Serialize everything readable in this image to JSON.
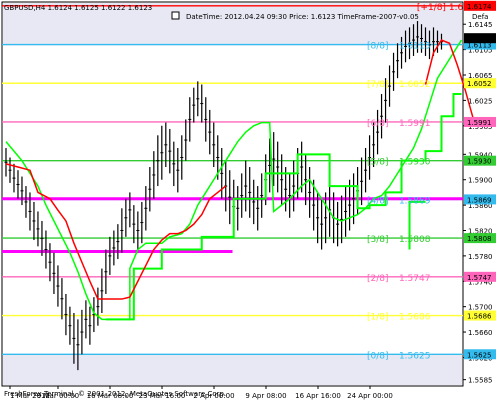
{
  "window": {
    "title": "GBPUSD,H4  1.6124 1.6125 1.6122 1.6123",
    "info_text": "DateTime: 2012.04.24 09:30   Price: 1.6123   TimeFrame-2007-v0.05",
    "info_right": "Defa",
    "copyright": "FreshForex Terminal, © 2001-2012, MetaQuotes Software Corp."
  },
  "colors": {
    "background": "#ffffff",
    "shade": "#e8e8f4",
    "candles": "#000000",
    "red_line": "#ff0000",
    "green_line": "#00ff00",
    "magenta_line": "#ff00ff"
  },
  "chart_data": {
    "type": "line",
    "symbol": "GBPUSD",
    "timeframe": "H4",
    "ylim": [
      1.5575,
      1.618
    ],
    "x_ticks": [
      "1 Mar 2012",
      "9 Mar 00:00",
      "16 Mar 08:00",
      "23 Mar 16:00",
      "2 Apr 00:00",
      "9 Apr 08:00",
      "16 Apr 16:00",
      "24 Apr 00:00"
    ],
    "y_ticks": [
      "1.6145",
      "1.6105",
      "1.6065",
      "1.6025",
      "1.5985",
      "1.5940",
      "1.5900",
      "1.5860",
      "1.5820",
      "1.5780",
      "1.5740",
      "1.5700",
      "1.5660",
      "1.5620",
      "1.5585"
    ],
    "murrey_levels": [
      {
        "label": "[+1/8]",
        "value": "1.6174",
        "y": 1.6174,
        "color": "#ff0000"
      },
      {
        "label": "[8/8]",
        "value": "1.6113",
        "y": 1.6113,
        "color": "#33bbee"
      },
      {
        "label": "[7/8]",
        "value": "1.6052",
        "y": 1.6052,
        "color": "#ffff33"
      },
      {
        "label": "[6/8]",
        "value": "1.5991",
        "y": 1.5991,
        "color": "#ff66bb"
      },
      {
        "label": "[5/8]",
        "value": "1.5930",
        "y": 1.593,
        "color": "#33cc33"
      },
      {
        "label": "[4/8]",
        "value": "1.5869",
        "y": 1.5869,
        "color": "#33bbee"
      },
      {
        "label": "[3/8]",
        "value": "1.5808",
        "y": 1.5808,
        "color": "#33cc33"
      },
      {
        "label": "[2/8]",
        "value": "1.5747",
        "y": 1.5747,
        "color": "#ff66bb"
      },
      {
        "label": "[1/8]",
        "value": "1.5686",
        "y": 1.5686,
        "color": "#ffff33"
      },
      {
        "label": "[0/8]",
        "value": "1.5625",
        "y": 1.5625,
        "color": "#33bbee"
      }
    ],
    "price_tags": [
      {
        "value": "1.6174",
        "y": 1.6174,
        "color": "#ff0000",
        "text_color": "#ffffff"
      },
      {
        "value": "1.6113",
        "y": 1.6113,
        "color": "#33bbee",
        "text_color": "#ffffff"
      },
      {
        "value": "1.6052",
        "y": 1.6052,
        "color": "#ffff33",
        "text_color": "#ffffff"
      },
      {
        "value": "1.5991",
        "y": 1.5991,
        "color": "#ff66bb",
        "text_color": "#ffffff"
      },
      {
        "value": "1.5930",
        "y": 1.593,
        "color": "#33cc33",
        "text_color": "#ffffff"
      },
      {
        "value": "1.5869",
        "y": 1.5869,
        "color": "#33bbee",
        "text_color": "#ffffff"
      },
      {
        "value": "1.5808",
        "y": 1.5808,
        "color": "#33cc33",
        "text_color": "#ffffff"
      },
      {
        "value": "1.5747",
        "y": 1.5747,
        "color": "#ff66bb",
        "text_color": "#ffffff"
      },
      {
        "value": "1.5686",
        "y": 1.5686,
        "color": "#ffff33",
        "text_color": "#ffffff"
      },
      {
        "value": "1.5625",
        "y": 1.5625,
        "color": "#33bbee",
        "text_color": "#ffffff"
      },
      {
        "value": "1.6123",
        "y": 1.6123,
        "color": "#000000",
        "text_color": "#ffffff"
      }
    ],
    "magenta_levels": [
      1.587,
      1.5787
    ],
    "red_line": [
      [
        1,
        1.5925
      ],
      [
        4,
        1.592
      ],
      [
        7,
        1.5915
      ],
      [
        9,
        1.588
      ],
      [
        12,
        1.587
      ],
      [
        14,
        1.5852
      ],
      [
        16,
        1.5835
      ],
      [
        18,
        1.58
      ],
      [
        20,
        1.577
      ],
      [
        22,
        1.574
      ],
      [
        24,
        1.5712
      ],
      [
        26,
        1.5712
      ],
      [
        30,
        1.5712
      ],
      [
        32,
        1.5715
      ],
      [
        34,
        1.574
      ],
      [
        36,
        1.5765
      ],
      [
        38,
        1.579
      ],
      [
        40,
        1.5805
      ],
      [
        42,
        1.5815
      ],
      [
        44,
        1.5815
      ],
      [
        46,
        1.582
      ],
      [
        48,
        1.583
      ],
      [
        50,
        1.5845
      ],
      [
        52,
        1.587
      ],
      [
        54,
        1.588
      ],
      [
        56,
        1.589
      ],
      [
        58,
        1.591
      ],
      [
        60,
        1.594
      ],
      [
        62,
        1.595
      ],
      [
        64,
        1.5955
      ],
      [
        66,
        1.599
      ],
      [
        68,
        1.6
      ],
      [
        70,
        1.599
      ],
      [
        72,
        1.596
      ],
      [
        74,
        1.594
      ],
      [
        76,
        1.591
      ],
      [
        78,
        1.589
      ],
      [
        80,
        1.587
      ],
      [
        82,
        1.585
      ],
      [
        84,
        1.585
      ],
      [
        86,
        1.5855
      ],
      [
        88,
        1.586
      ],
      [
        90,
        1.587
      ],
      [
        92,
        1.5875
      ],
      [
        94,
        1.587
      ],
      [
        96,
        1.588
      ],
      [
        98,
        1.59
      ],
      [
        100,
        1.593
      ],
      [
        102,
        1.596
      ],
      [
        104,
        1.6
      ],
      [
        106,
        1.605
      ],
      [
        108,
        1.61
      ],
      [
        110,
        1.612
      ],
      [
        112,
        1.6115
      ],
      [
        114,
        1.608
      ],
      [
        116,
        1.604
      ],
      [
        118,
        1.5995
      ]
    ],
    "green_line": [
      [
        1,
        1.596
      ],
      [
        3,
        1.5945
      ],
      [
        5,
        1.593
      ],
      [
        7,
        1.591
      ],
      [
        9,
        1.589
      ],
      [
        11,
        1.586
      ],
      [
        13,
        1.5835
      ],
      [
        15,
        1.581
      ],
      [
        17,
        1.5785
      ],
      [
        19,
        1.5755
      ],
      [
        21,
        1.572
      ],
      [
        23,
        1.569
      ],
      [
        25,
        1.568
      ],
      [
        30,
        1.568
      ],
      [
        32,
        1.568
      ],
      [
        32,
        1.576
      ],
      [
        34,
        1.579
      ],
      [
        36,
        1.58
      ],
      [
        40,
        1.58
      ],
      [
        42,
        1.581
      ],
      [
        45,
        1.5815
      ],
      [
        47,
        1.583
      ],
      [
        49,
        1.586
      ],
      [
        51,
        1.588
      ],
      [
        53,
        1.59
      ],
      [
        55,
        1.592
      ],
      [
        57,
        1.594
      ],
      [
        59,
        1.596
      ],
      [
        61,
        1.5975
      ],
      [
        63,
        1.5985
      ],
      [
        65,
        1.599
      ],
      [
        67,
        1.599
      ],
      [
        68,
        1.585
      ],
      [
        70,
        1.586
      ],
      [
        72,
        1.587
      ],
      [
        75,
        1.589
      ],
      [
        77,
        1.59
      ],
      [
        79,
        1.588
      ],
      [
        81,
        1.586
      ],
      [
        83,
        1.584
      ],
      [
        85,
        1.5835
      ],
      [
        87,
        1.584
      ],
      [
        89,
        1.5845
      ],
      [
        91,
        1.5855
      ],
      [
        93,
        1.587
      ],
      [
        95,
        1.5875
      ],
      [
        97,
        1.589
      ],
      [
        99,
        1.591
      ],
      [
        101,
        1.593
      ],
      [
        103,
        1.595
      ],
      [
        105,
        1.598
      ],
      [
        107,
        1.602
      ],
      [
        109,
        1.606
      ],
      [
        111,
        1.608
      ],
      [
        113,
        1.61
      ],
      [
        115,
        1.612
      ]
    ],
    "stepped_green": [
      [
        26,
        1.568
      ],
      [
        33,
        1.568
      ],
      [
        33,
        1.576
      ],
      [
        40,
        1.576
      ],
      [
        40,
        1.579
      ],
      [
        50,
        1.579
      ],
      [
        50,
        1.581
      ],
      [
        58,
        1.581
      ],
      [
        58,
        1.587
      ],
      [
        66,
        1.587
      ],
      [
        66,
        1.591
      ],
      [
        74,
        1.591
      ],
      [
        74,
        1.594
      ],
      [
        82,
        1.594
      ],
      [
        82,
        1.589
      ],
      [
        89,
        1.589
      ],
      [
        89,
        1.5855
      ],
      [
        92,
        1.5855
      ],
      [
        92,
        1.586
      ],
      [
        96,
        1.586
      ],
      [
        96,
        1.588
      ],
      [
        100,
        1.588
      ],
      [
        100,
        1.593
      ],
      [
        106,
        1.593
      ],
      [
        106,
        1.5945
      ],
      [
        110,
        1.5945
      ],
      [
        110,
        1.6
      ],
      [
        113,
        1.6
      ],
      [
        113,
        1.6035
      ],
      [
        115,
        1.6035
      ]
    ],
    "second_step": [
      [
        102,
        1.579
      ],
      [
        102,
        1.5865
      ],
      [
        106,
        1.5865
      ]
    ],
    "candles_hl": [
      [
        1,
        1.595,
        1.5905
      ],
      [
        2,
        1.5935,
        1.5895
      ],
      [
        3,
        1.5925,
        1.588
      ],
      [
        4,
        1.5915,
        1.587
      ],
      [
        5,
        1.5905,
        1.586
      ],
      [
        6,
        1.589,
        1.584
      ],
      [
        7,
        1.588,
        1.582
      ],
      [
        8,
        1.5865,
        1.5805
      ],
      [
        9,
        1.585,
        1.5795
      ],
      [
        10,
        1.5835,
        1.578
      ],
      [
        11,
        1.582,
        1.576
      ],
      [
        12,
        1.58,
        1.574
      ],
      [
        13,
        1.5785,
        1.572
      ],
      [
        14,
        1.5765,
        1.57
      ],
      [
        15,
        1.5745,
        1.568
      ],
      [
        16,
        1.572,
        1.5655
      ],
      [
        17,
        1.57,
        1.564
      ],
      [
        18,
        1.569,
        1.561
      ],
      [
        19,
        1.568,
        1.56
      ],
      [
        20,
        1.5695,
        1.5625
      ],
      [
        21,
        1.571,
        1.565
      ],
      [
        22,
        1.57,
        1.564
      ],
      [
        23,
        1.5715,
        1.566
      ],
      [
        24,
        1.573,
        1.567
      ],
      [
        25,
        1.576,
        1.569
      ],
      [
        26,
        1.579,
        1.572
      ],
      [
        27,
        1.581,
        1.575
      ],
      [
        28,
        1.582,
        1.5765
      ],
      [
        29,
        1.583,
        1.5775
      ],
      [
        30,
        1.5855,
        1.5785
      ],
      [
        31,
        1.587,
        1.581
      ],
      [
        32,
        1.588,
        1.5825
      ],
      [
        33,
        1.586,
        1.58
      ],
      [
        34,
        1.585,
        1.579
      ],
      [
        35,
        1.5865,
        1.58
      ],
      [
        36,
        1.589,
        1.582
      ],
      [
        37,
        1.592,
        1.585
      ],
      [
        38,
        1.5945,
        1.587
      ],
      [
        39,
        1.597,
        1.589
      ],
      [
        40,
        1.5985,
        1.59
      ],
      [
        41,
        1.599,
        1.592
      ],
      [
        42,
        1.598,
        1.591
      ],
      [
        43,
        1.596,
        1.589
      ],
      [
        44,
        1.595,
        1.588
      ],
      [
        45,
        1.597,
        1.59
      ],
      [
        46,
        1.5995,
        1.593
      ],
      [
        47,
        1.603,
        1.596
      ],
      [
        48,
        1.6045,
        1.599
      ],
      [
        49,
        1.6055,
        1.6
      ],
      [
        50,
        1.605,
        1.599
      ],
      [
        51,
        1.603,
        1.596
      ],
      [
        52,
        1.601,
        1.594
      ],
      [
        53,
        1.599,
        1.592
      ],
      [
        54,
        1.597,
        1.59
      ],
      [
        55,
        1.595,
        1.587
      ],
      [
        56,
        1.593,
        1.585
      ],
      [
        57,
        1.5915,
        1.583
      ],
      [
        58,
        1.59,
        1.5815
      ],
      [
        59,
        1.589,
        1.582
      ],
      [
        60,
        1.591,
        1.584
      ],
      [
        61,
        1.593,
        1.585
      ],
      [
        62,
        1.592,
        1.584
      ],
      [
        63,
        1.59,
        1.583
      ],
      [
        64,
        1.589,
        1.582
      ],
      [
        65,
        1.591,
        1.584
      ],
      [
        66,
        1.594,
        1.586
      ],
      [
        67,
        1.5965,
        1.588
      ],
      [
        68,
        1.5975,
        1.589
      ],
      [
        69,
        1.596,
        1.588
      ],
      [
        70,
        1.594,
        1.586
      ],
      [
        71,
        1.592,
        1.585
      ],
      [
        72,
        1.591,
        1.584
      ],
      [
        73,
        1.593,
        1.585
      ],
      [
        74,
        1.595,
        1.587
      ],
      [
        75,
        1.596,
        1.588
      ],
      [
        76,
        1.594,
        1.586
      ],
      [
        77,
        1.592,
        1.584
      ],
      [
        78,
        1.59,
        1.582
      ],
      [
        79,
        1.588,
        1.58
      ],
      [
        80,
        1.587,
        1.579
      ],
      [
        81,
        1.588,
        1.58
      ],
      [
        82,
        1.5895,
        1.581
      ],
      [
        83,
        1.588,
        1.58
      ],
      [
        84,
        1.5865,
        1.5795
      ],
      [
        85,
        1.5875,
        1.58
      ],
      [
        86,
        1.589,
        1.581
      ],
      [
        87,
        1.59,
        1.582
      ],
      [
        88,
        1.591,
        1.583
      ],
      [
        89,
        1.592,
        1.5845
      ],
      [
        90,
        1.5935,
        1.586
      ],
      [
        91,
        1.595,
        1.588
      ],
      [
        92,
        1.597,
        1.59
      ],
      [
        93,
        1.599,
        1.592
      ],
      [
        94,
        1.601,
        1.594
      ],
      [
        95,
        1.6035,
        1.5965
      ],
      [
        96,
        1.606,
        1.599
      ],
      [
        97,
        1.608,
        1.6015
      ],
      [
        98,
        1.61,
        1.604
      ],
      [
        99,
        1.6115,
        1.606
      ],
      [
        100,
        1.6125,
        1.6075
      ],
      [
        101,
        1.6135,
        1.6085
      ],
      [
        102,
        1.614,
        1.609
      ],
      [
        103,
        1.6145,
        1.6095
      ],
      [
        104,
        1.615,
        1.61
      ],
      [
        105,
        1.6145,
        1.61
      ],
      [
        106,
        1.614,
        1.6095
      ],
      [
        107,
        1.6135,
        1.609
      ],
      [
        108,
        1.614,
        1.6095
      ],
      [
        109,
        1.6135,
        1.61
      ],
      [
        110,
        1.613,
        1.6105
      ]
    ]
  }
}
